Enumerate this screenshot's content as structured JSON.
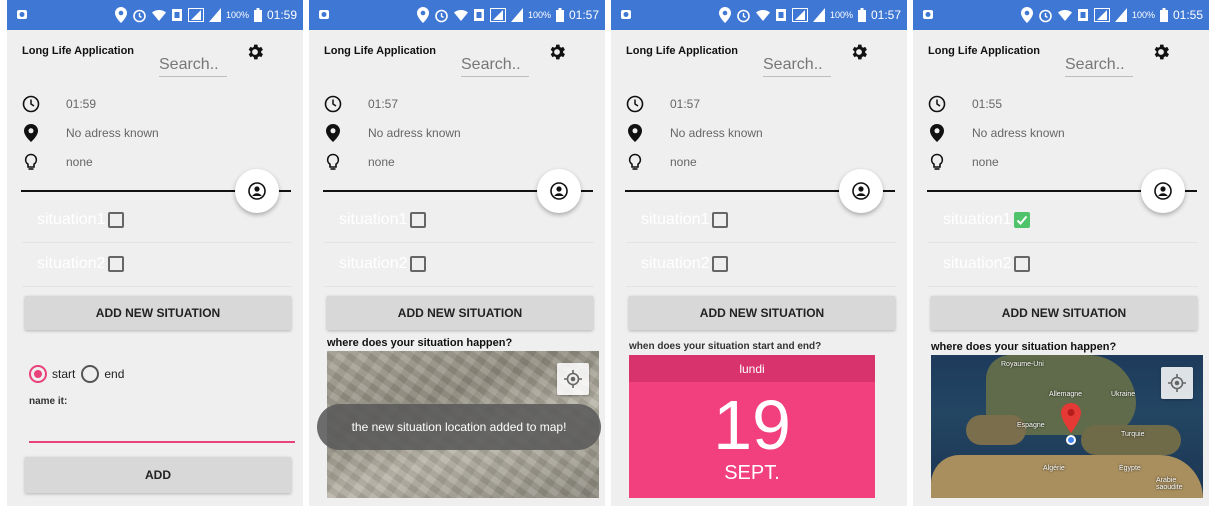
{
  "colors": {
    "statusbar": "#3e77d4",
    "accent_pink": "#e9417a",
    "calendar_pink": "#f23f7d",
    "check_green": "#4fc36a"
  },
  "screens": [
    {
      "status": {
        "battery": "100%",
        "time": "01:59"
      },
      "app_title": "Long Life Application",
      "search_placeholder": "Search..",
      "info": {
        "time": "01:59",
        "address": "No adress known",
        "value": "none"
      },
      "situations": [
        {
          "label": "situation1",
          "checked": false
        },
        {
          "label": "situation2",
          "checked": false
        }
      ],
      "add_situation_label": "ADD NEW SITUATION",
      "radio": {
        "start": "start",
        "end": "end",
        "selected": "start"
      },
      "name_it_label": "name it:",
      "add_label": "ADD"
    },
    {
      "status": {
        "battery": "100%",
        "time": "01:57"
      },
      "app_title": "Long Life Application",
      "search_placeholder": "Search..",
      "info": {
        "time": "01:57",
        "address": "No adress known",
        "value": "none"
      },
      "situations": [
        {
          "label": "situation1",
          "checked": false
        },
        {
          "label": "situation2",
          "checked": false
        }
      ],
      "add_situation_label": "ADD NEW SITUATION",
      "section_label": "where does your situation happen?",
      "toast": "the new situation location added to map!"
    },
    {
      "status": {
        "battery": "100%",
        "time": "01:57"
      },
      "app_title": "Long Life Application",
      "search_placeholder": "Search..",
      "info": {
        "time": "01:57",
        "address": "No adress known",
        "value": "none"
      },
      "situations": [
        {
          "label": "situation1",
          "checked": false
        },
        {
          "label": "situation2",
          "checked": false
        }
      ],
      "add_situation_label": "ADD NEW SITUATION",
      "section_label": "when does your situation start and end?",
      "calendar": {
        "weekday": "lundi",
        "day": "19",
        "month": "SEPT."
      }
    },
    {
      "status": {
        "battery": "100%",
        "time": "01:55"
      },
      "app_title": "Long Life Application",
      "search_placeholder": "Search..",
      "info": {
        "time": "01:55",
        "address": "No adress known",
        "value": "none"
      },
      "situations": [
        {
          "label": "situation1",
          "checked": true
        },
        {
          "label": "situation2",
          "checked": false
        }
      ],
      "add_situation_label": "ADD NEW SITUATION",
      "section_label": "where does your situation happen?",
      "map_labels": {
        "uk": "Royaume-Uni",
        "germany": "Allemagne",
        "ukraine": "Ukraine",
        "spain": "Espagne",
        "turkey": "Turquie",
        "algeria": "Algérie",
        "egypt": "Égypte",
        "saudi": "Arabie saoudite"
      }
    }
  ]
}
